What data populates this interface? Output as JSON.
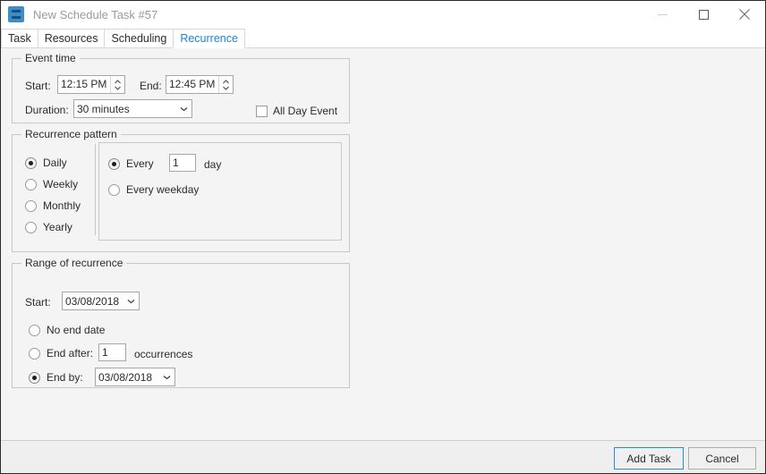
{
  "window": {
    "title": "New Schedule Task #57",
    "app_icon": "schedule-task-icon",
    "controls": {
      "minimize": "minimize-icon",
      "maximize": "maximize-icon",
      "close": "close-icon"
    }
  },
  "tabs": [
    {
      "label": "Task",
      "active": false
    },
    {
      "label": "Resources",
      "active": false
    },
    {
      "label": "Scheduling",
      "active": false
    },
    {
      "label": "Recurrence",
      "active": true
    }
  ],
  "event_time": {
    "legend": "Event time",
    "start_label": "Start:",
    "start_value": "12:15 PM",
    "end_label": "End:",
    "end_value": "12:45 PM",
    "duration_label": "Duration:",
    "duration_value": "30 minutes",
    "all_day_label": "All Day Event",
    "all_day_checked": false
  },
  "recurrence_pattern": {
    "legend": "Recurrence pattern",
    "frequency_options": [
      {
        "label": "Daily",
        "selected": true
      },
      {
        "label": "Weekly",
        "selected": false
      },
      {
        "label": "Monthly",
        "selected": false
      },
      {
        "label": "Yearly",
        "selected": false
      }
    ],
    "every_label": "Every",
    "every_value": "1",
    "every_unit": "day",
    "every_selected": true,
    "every_weekday_label": "Every weekday",
    "every_weekday_selected": false
  },
  "range_of_recurrence": {
    "legend": "Range of recurrence",
    "start_label": "Start:",
    "start_value": "03/08/2018",
    "no_end_date_label": "No end date",
    "no_end_date_selected": false,
    "end_after_label": "End after:",
    "end_after_value": "1",
    "end_after_unit": "occurrences",
    "end_after_selected": false,
    "end_by_label": "End by:",
    "end_by_value": "03/08/2018",
    "end_by_selected": true
  },
  "footer": {
    "add_task_label": "Add Task",
    "cancel_label": "Cancel"
  },
  "colors": {
    "accent": "#1a84d6",
    "default_button_border": "#2a8ada",
    "icon_blue": "#3f8ccb",
    "content_bg": "#f4f4f4",
    "footer_bg": "#efefef"
  }
}
